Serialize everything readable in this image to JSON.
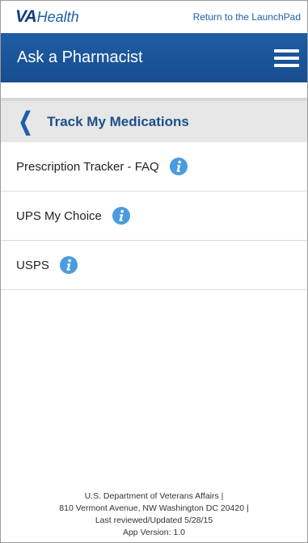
{
  "header": {
    "logo_va": "VA",
    "logo_health": "Health",
    "launchpad_link": "Return to the LaunchPad"
  },
  "appbar": {
    "title": "Ask a Pharmacist",
    "menu_icon": "hamburger-menu-icon"
  },
  "section": {
    "back_icon": "chevron-left-icon",
    "title": "Track My Medications"
  },
  "items": [
    {
      "label": "Prescription Tracker - FAQ",
      "icon": "info-icon"
    },
    {
      "label": "UPS My Choice",
      "icon": "info-icon"
    },
    {
      "label": "USPS",
      "icon": "info-icon"
    }
  ],
  "footer": {
    "line1": "U.S. Department of Veterans Affairs |",
    "line2": "810 Vermont Avenue, NW Washington DC 20420 |",
    "line3": "Last reviewed/Updated 5/28/15",
    "line4": "App Version: 1.0"
  },
  "colors": {
    "brand_blue": "#1d5ea8",
    "navy": "#123d7a",
    "info_blue": "#4a9be0"
  }
}
